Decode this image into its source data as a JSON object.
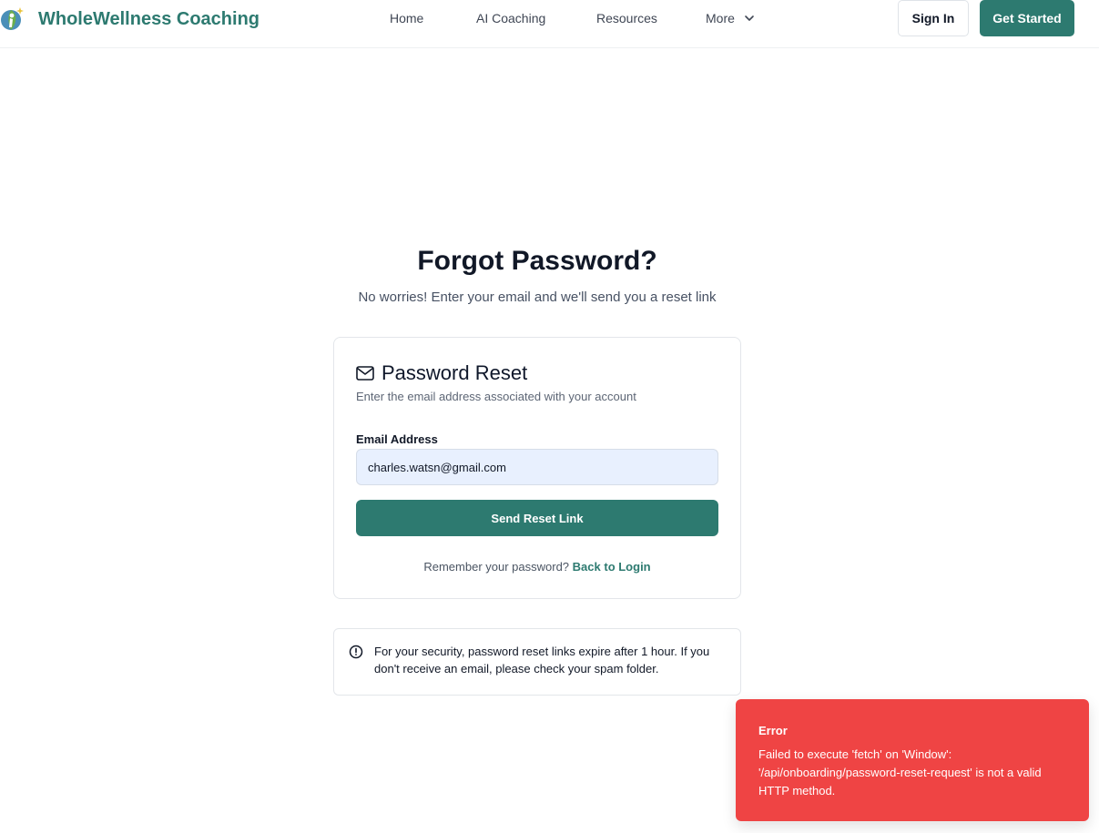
{
  "nav": {
    "brand": "WholeWellness Coaching",
    "links": [
      "Home",
      "AI Coaching",
      "Resources",
      "More"
    ],
    "sign_in": "Sign In",
    "get_started": "Get Started"
  },
  "page": {
    "title": "Forgot Password?",
    "subtitle": "No worries! Enter your email and we'll send you a reset link"
  },
  "card": {
    "title": "Password Reset",
    "description": "Enter the email address associated with your account",
    "email_label": "Email Address",
    "email_value": "charles.watsn@gmail.com",
    "submit": "Send Reset Link",
    "remember_text": "Remember your password?",
    "back_link": "Back to Login"
  },
  "notice": {
    "text": "For your security, password reset links expire after 1 hour. If you don't receive an email, please check your spam folder."
  },
  "toast": {
    "title": "Error",
    "message": "Failed to execute 'fetch' on 'Window': '/api/onboarding/password-reset-request' is not a valid HTTP method."
  },
  "colors": {
    "brand": "#2d7a70",
    "error": "#ef4444",
    "input_bg": "#e8f0fe"
  },
  "icons": [
    "wellness-logo-icon",
    "chevron-down-icon",
    "mail-icon",
    "info-circle-icon"
  ]
}
